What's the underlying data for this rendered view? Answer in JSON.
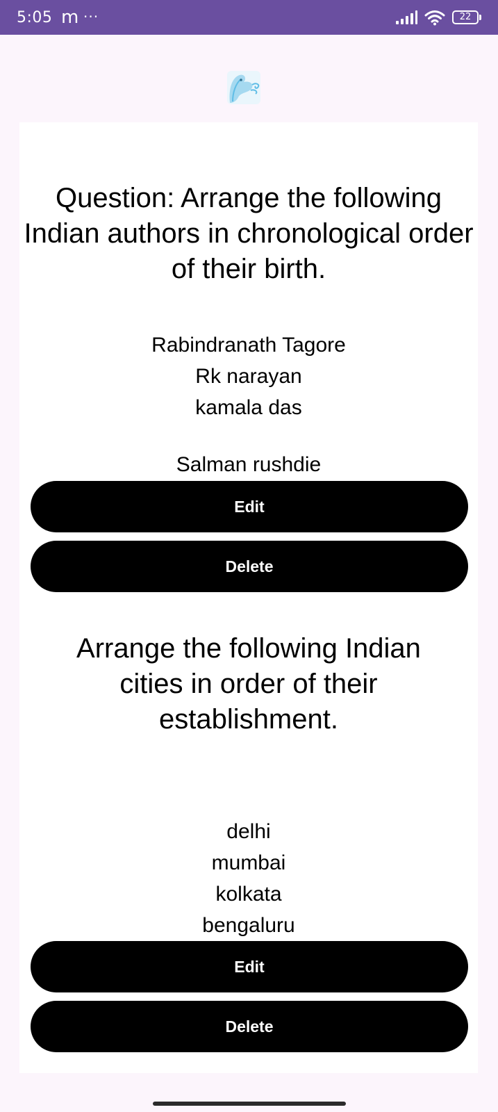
{
  "status_bar": {
    "time": "5:05",
    "app_icon": "m",
    "more": "···",
    "battery": "22",
    "icons": [
      "signal-icon",
      "wifi-icon",
      "battery-icon"
    ]
  },
  "app": {
    "logo": "bird-logo-icon",
    "accent_color": "#6a4fa0"
  },
  "questions": [
    {
      "question": "Question: Arrange the following Indian authors in chronological order of their birth.",
      "options": [
        "Rabindranath Tagore",
        "Rk narayan",
        "kamala das",
        "Salman rushdie"
      ],
      "edit_label": "Edit",
      "delete_label": "Delete"
    },
    {
      "question": "Arrange the following Indian cities in order of their establishment.",
      "options": [
        "delhi",
        "mumbai",
        "kolkata",
        "bengaluru"
      ],
      "edit_label": "Edit",
      "delete_label": "Delete"
    }
  ]
}
